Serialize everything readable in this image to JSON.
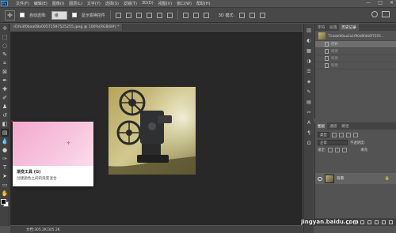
{
  "app": {
    "logo": "Ps"
  },
  "menu": [
    "文件(F)",
    "编辑(E)",
    "图像(I)",
    "图层(L)",
    "文字(Y)",
    "选择(S)",
    "滤镜(T)",
    "3D(D)",
    "视图(V)",
    "窗口(W)",
    "帮助(H)"
  ],
  "window_controls": {
    "minimize": "—",
    "maximize": "□",
    "close": "✕"
  },
  "options": {
    "auto_select_label": "自动选择:",
    "auto_select_value": "组",
    "show_transform_label": "显示变换控件",
    "mode_3d_label": "3D 模式:"
  },
  "document": {
    "tab_title": "d1fe3f0baa08a00571597525255.jpeg @ 100%(RGB/8#) *",
    "status_text": "文档:305.2K/305.2K"
  },
  "tooltip": {
    "title": "渐变工具 (G)",
    "description": "创建颜色之间的渐变混合"
  },
  "history_panel": {
    "tabs": [
      "字符",
      "段落",
      "历史记录"
    ],
    "active_tab": "历史记录",
    "snapshot_name": "71ddefd0aa2a1f90d0fd40f7255...",
    "rows": [
      {
        "label": "打开",
        "selected": true
      },
      {
        "label": "新建",
        "selected": false
      },
      {
        "label": "新建",
        "selected": false
      },
      {
        "label": "新建",
        "selected": false
      }
    ]
  },
  "layers_panel": {
    "tabs": [
      "图层",
      "通道",
      "路径"
    ],
    "active_tab": "图层",
    "kind_filter": "类型",
    "blend_mode": "正常",
    "opacity_label": "不透明度:",
    "lock_label": "锁定:",
    "fill_label": "填充:",
    "layer_name": "背景"
  },
  "watermark": "jingyan.baidu.com",
  "colors": {
    "tooltip_gradient": "#f3a9cf",
    "arrow": "#e5262d",
    "canvas_bg": "#282828"
  }
}
